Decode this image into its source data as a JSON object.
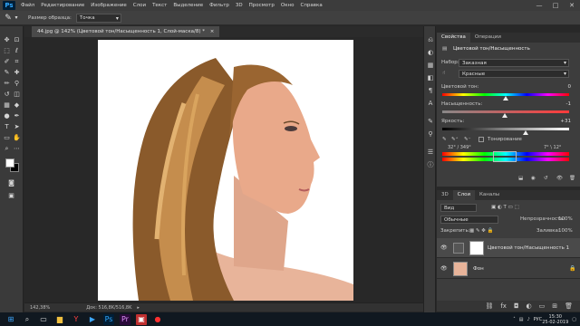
{
  "app": {
    "logo": "Ps"
  },
  "menu": [
    "Файл",
    "Редактирование",
    "Изображение",
    "Слои",
    "Текст",
    "Выделение",
    "Фильтр",
    "3D",
    "Просмотр",
    "Окно",
    "Справка"
  ],
  "window_controls": {
    "minimize": "—",
    "maximize": "□",
    "close": "✕"
  },
  "options": {
    "sample_size_label": "Размер образца:",
    "sample_size_value": "Точка"
  },
  "document": {
    "tab_title": "44.jpg @ 142% (Цветовой тон/Насыщенность 1, Слой-маска/8) *",
    "tab_close": "×"
  },
  "status": {
    "zoom": "142,38%",
    "doc_info": "Док: 516,8K/516,8K"
  },
  "properties": {
    "tabs": [
      "Свойства",
      "Операции"
    ],
    "header": "Цветовой тон/Насыщенность",
    "preset_label": "Набор:",
    "preset_value": "Заказная",
    "channel_value": "Красные",
    "hue_label": "Цветовой тон:",
    "hue_value": "0",
    "hue_position": 0.5,
    "saturation_label": "Насыщенность:",
    "saturation_value": "-1",
    "saturation_position": 0.495,
    "lightness_label": "Яркость:",
    "lightness_value": "+31",
    "lightness_position": 0.655,
    "colorize_label": "Тонирование",
    "range_left": "32° / 349°",
    "range_right": "7° \\ 12°"
  },
  "layers": {
    "tabs": [
      "3D",
      "Слои",
      "Каналы"
    ],
    "filter_value": "Вид",
    "blend_mode": "Обычные",
    "opacity_label": "Непрозрачность:",
    "opacity_value": "100%",
    "lock_label": "Закрепить:",
    "fill_label": "Заливка:",
    "fill_value": "100%",
    "items": [
      {
        "name": "Цветовой тон/Насыщенность 1"
      },
      {
        "name": "Фон"
      }
    ]
  },
  "taskbar": {
    "language": "РУС",
    "time": "15:30",
    "date": "25-02-2019"
  }
}
